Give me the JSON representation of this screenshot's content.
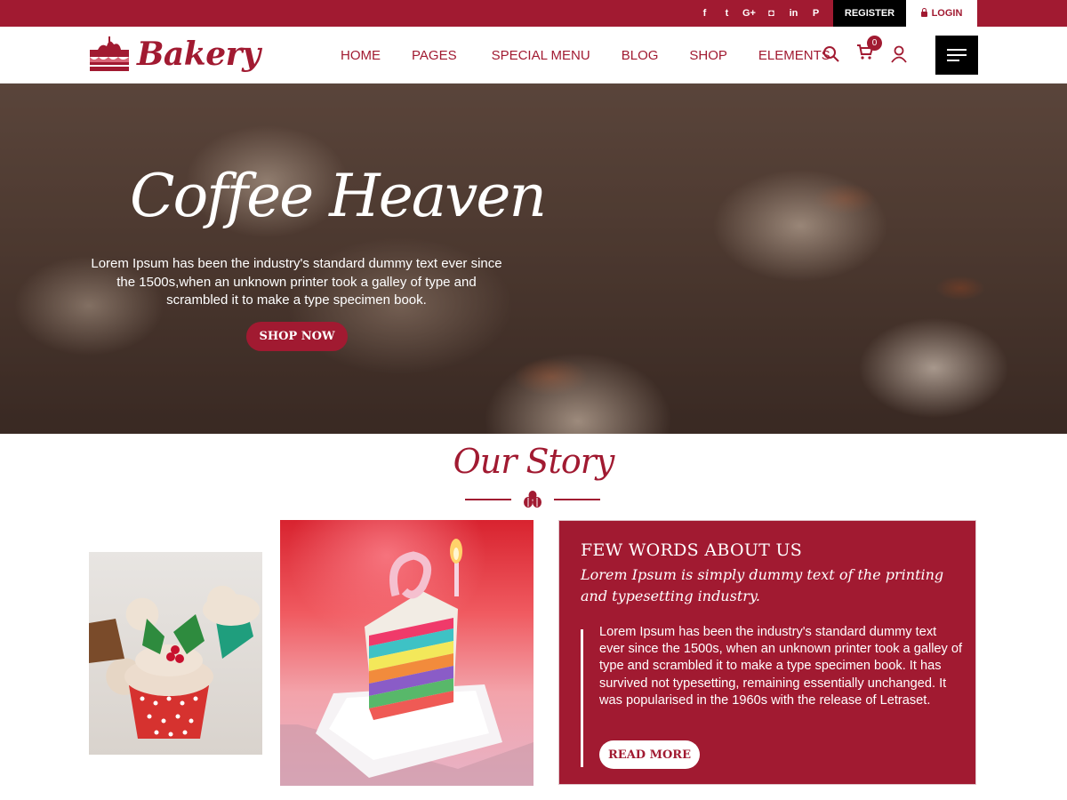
{
  "topbar": {
    "social": [
      {
        "icon": "facebook-icon",
        "glyph": "f"
      },
      {
        "icon": "twitter-icon",
        "glyph": "t"
      },
      {
        "icon": "google-plus-icon",
        "glyph": "G+"
      },
      {
        "icon": "instagram-icon",
        "glyph": "◘"
      },
      {
        "icon": "linkedin-icon",
        "glyph": "in"
      },
      {
        "icon": "pinterest-icon",
        "glyph": "P"
      }
    ],
    "register_label": "REGISTER",
    "login_label": "LOGIN"
  },
  "header": {
    "logo_text": "Bakery",
    "nav": [
      "HOME",
      "PAGES",
      "SPECIAL MENU",
      "BLOG",
      "SHOP",
      "ELEMENTS"
    ],
    "cart_count": "0"
  },
  "hero": {
    "title": "Coffee Heaven",
    "text": "Lorem Ipsum has been the industry's standard dummy text ever since the 1500s,when an unknown printer took a galley of type and scrambled it to make a type specimen book.",
    "button_label": "SHOP NOW"
  },
  "story": {
    "title": "Our Story",
    "about_heading": "FEW WORDS ABOUT US",
    "about_subheading": "Lorem Ipsum is simply dummy text of the printing and typesetting industry.",
    "about_body": "Lorem Ipsum has been the industry's standard dummy text ever since the 1500s, when an unknown printer took a galley of type and scrambled it to make a type specimen book. It has survived not typesetting, remaining essentially unchanged. It was popularised in the 1960s with the release of Letraset.",
    "read_more_label": "READ MORE"
  },
  "colors": {
    "brand": "#a11a31",
    "dark": "#000000",
    "white": "#ffffff"
  }
}
